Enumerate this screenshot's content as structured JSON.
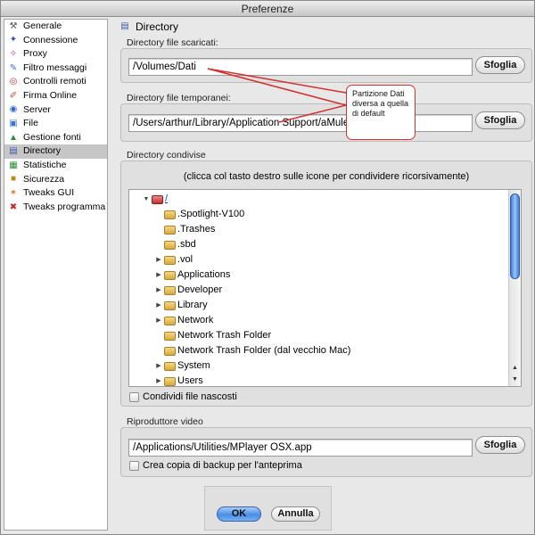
{
  "window": {
    "title": "Preferenze"
  },
  "sidebar": {
    "items": [
      {
        "label": "Generale",
        "icon": "wrench-icon"
      },
      {
        "label": "Connessione",
        "icon": "connection-icon"
      },
      {
        "label": "Proxy",
        "icon": "proxy-icon"
      },
      {
        "label": "Filtro messaggi",
        "icon": "filter-icon"
      },
      {
        "label": "Controlli remoti",
        "icon": "remote-icon"
      },
      {
        "label": "Firma Online",
        "icon": "signature-icon"
      },
      {
        "label": "Server",
        "icon": "server-icon"
      },
      {
        "label": "File",
        "icon": "file-icon"
      },
      {
        "label": "Gestione fonti",
        "icon": "sources-icon"
      },
      {
        "label": "Directory",
        "icon": "directory-icon",
        "selected": true
      },
      {
        "label": "Statistiche",
        "icon": "statistics-icon"
      },
      {
        "label": "Sicurezza",
        "icon": "lock-icon"
      },
      {
        "label": "Tweaks GUI",
        "icon": "tweaks-gui-icon"
      },
      {
        "label": "Tweaks programma",
        "icon": "tweaks-program-icon"
      }
    ]
  },
  "header": {
    "title": "Directory"
  },
  "download_dir": {
    "label": "Directory file scaricati:",
    "value": "/Volumes/Dati",
    "browse_label": "Sfoglia"
  },
  "temp_dir": {
    "label": "Directory file temporanei:",
    "value": "/Users/arthur/Library/Application Support/aMule",
    "browse_label": "Sfoglia"
  },
  "annotation": {
    "text": "Partizione Dati diversa a quella di default"
  },
  "shared": {
    "label": "Directory condivise",
    "hint": "(clicca col tasto destro sulle icone per condividere ricorsivamente)",
    "tree": [
      {
        "label": "/",
        "level": 0,
        "expanded": true,
        "root": true
      },
      {
        "label": ".Spotlight-V100",
        "level": 1,
        "expandable": false
      },
      {
        "label": ".Trashes",
        "level": 1,
        "expandable": false
      },
      {
        "label": ".sbd",
        "level": 1,
        "expandable": false
      },
      {
        "label": ".vol",
        "level": 1,
        "expandable": true
      },
      {
        "label": "Applications",
        "level": 1,
        "expandable": true
      },
      {
        "label": "Developer",
        "level": 1,
        "expandable": true
      },
      {
        "label": "Library",
        "level": 1,
        "expandable": true
      },
      {
        "label": "Network",
        "level": 1,
        "expandable": true
      },
      {
        "label": "Network Trash Folder",
        "level": 1,
        "expandable": false
      },
      {
        "label": "Network Trash Folder (dal vecchio Mac)",
        "level": 1,
        "expandable": false
      },
      {
        "label": "System",
        "level": 1,
        "expandable": true
      },
      {
        "label": "Users",
        "level": 1,
        "expandable": true
      }
    ],
    "hidden_files_label": "Condividi file nascosti"
  },
  "video": {
    "label": "Riproduttore video",
    "value": "/Applications/Utilities/MPlayer OSX.app",
    "browse_label": "Sfoglia",
    "backup_label": "Crea copia di backup per l'anteprima"
  },
  "buttons": {
    "ok": "OK",
    "cancel": "Annulla"
  },
  "colors": {
    "annotation": "#d03030",
    "selection": "#c6c6c6",
    "accent": "#4a8ce4"
  }
}
